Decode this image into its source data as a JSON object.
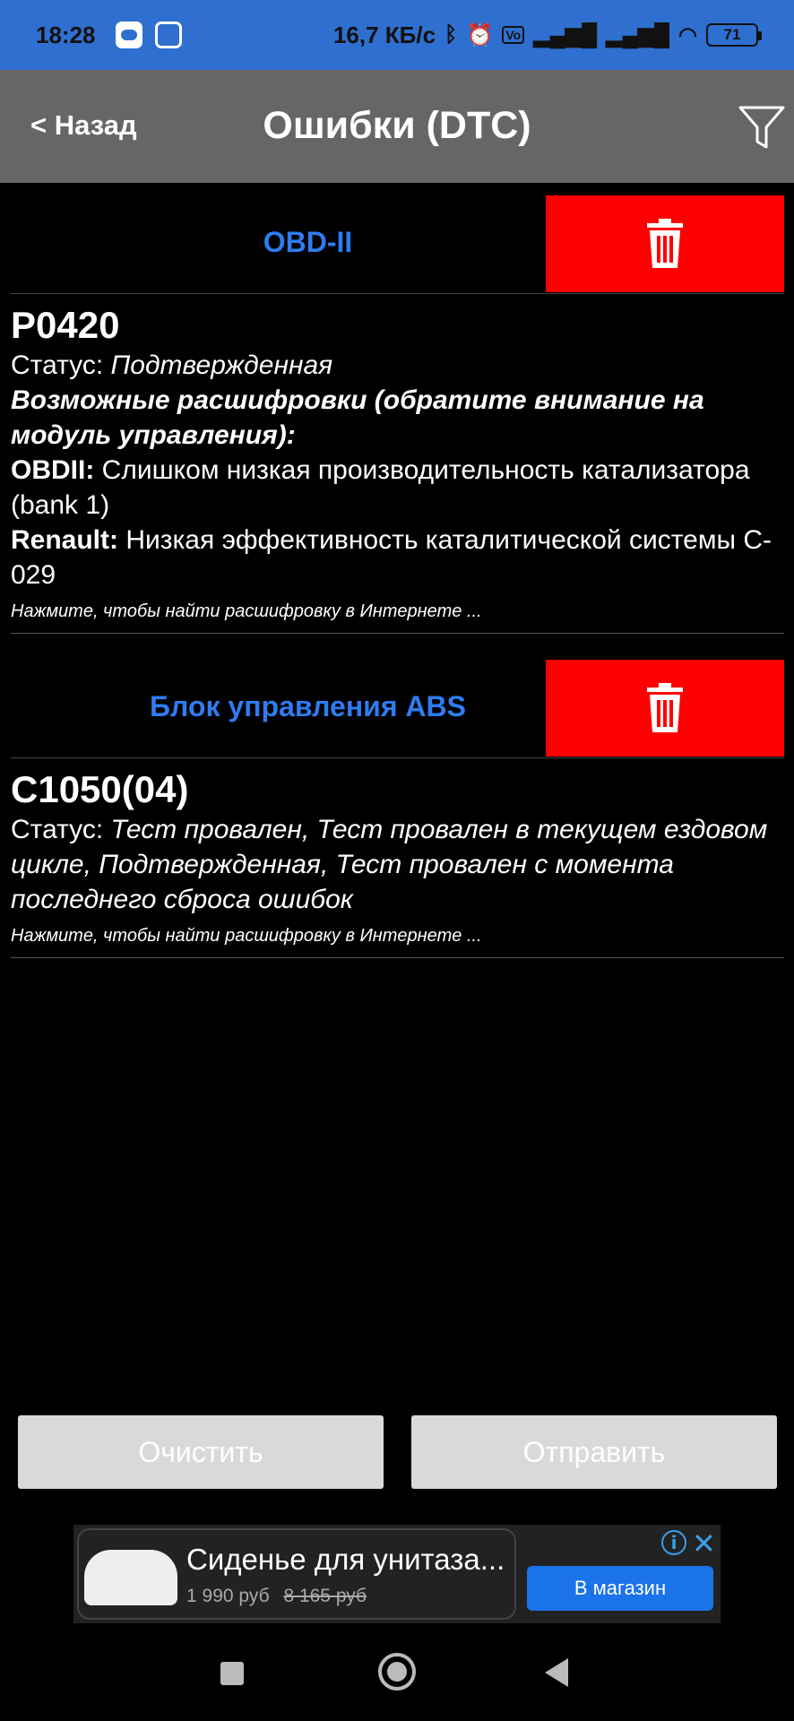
{
  "status_bar": {
    "time": "18:28",
    "net_speed": "16,7 КБ/с",
    "battery": "71",
    "icons": [
      "app-icon",
      "app-icon",
      "bluetooth-icon",
      "alarm-icon",
      "volte-icon",
      "signal-icon",
      "signal-icon",
      "wifi-icon",
      "battery-icon"
    ]
  },
  "header": {
    "back_label": "< Назад",
    "title": "Ошибки (DTC)",
    "filter_icon": "filter-icon"
  },
  "sections": [
    {
      "title": "OBD-II",
      "delete_icon": "trash-icon",
      "code": "P0420",
      "status_label": "Статус:",
      "status_value": "Подтвержденная",
      "decodings_heading": "Возможные расшифровки (обратите внимание на модуль управления):",
      "decodings": [
        {
          "source": "OBDII:",
          "text": "Слишком низкая производительность катализатора (bank 1)"
        },
        {
          "source": "Renault:",
          "text": "Низкая эффективность каталитической системы C-029"
        }
      ],
      "hint": "Нажмите, чтобы найти расшифровку в Интернете ..."
    },
    {
      "title": "Блок управления ABS",
      "delete_icon": "trash-icon",
      "code": "C1050(04)",
      "status_label": "Статус:",
      "status_value": "Тест провален, Тест провален в текущем ездовом цикле, Подтвержденная, Тест провален с момента последнего сброса ошибок",
      "hint": "Нажмите, чтобы найти расшифровку в Интернете ..."
    }
  ],
  "buttons": {
    "clear": "Очистить",
    "send": "Отправить"
  },
  "ad": {
    "title": "Сиденье для унитаза...",
    "price": "1 990 руб",
    "old_price": "8 165 руб",
    "cta": "В магазин",
    "info": "i",
    "close": "✕"
  },
  "colors": {
    "status_bar": "#2f6fcf",
    "header": "#666666",
    "section_title": "#2e7cf0",
    "delete": "#ff0000",
    "button": "#d9d9d9",
    "ad_cta": "#1a73e8"
  }
}
